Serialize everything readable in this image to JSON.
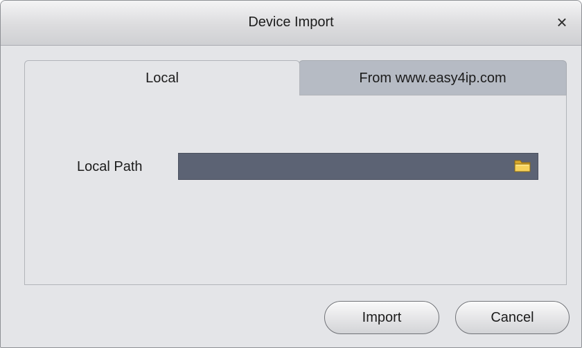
{
  "dialog": {
    "title": "Device Import",
    "close_label": "×"
  },
  "tabs": [
    {
      "label": "Local",
      "active": true
    },
    {
      "label": "From www.easy4ip.com",
      "active": false
    }
  ],
  "local": {
    "path_label": "Local Path",
    "path_value": "",
    "folder_icon": "folder-icon"
  },
  "buttons": {
    "import_label": "Import",
    "cancel_label": "Cancel"
  },
  "colors": {
    "dialog_bg": "#e4e5e8",
    "inactive_tab": "#b6bbc4",
    "path_field": "#5c6374",
    "folder": "#f0c43a"
  }
}
